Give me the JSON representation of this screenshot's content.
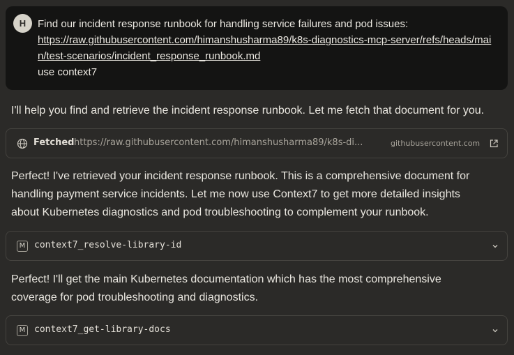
{
  "user_message": {
    "avatar_initial": "H",
    "line1": "Find our incident response runbook for handling service failures and pod issues:",
    "link": "https://raw.githubusercontent.com/himanshusharma89/k8s-diagnostics-mcp-server/refs/heads/main/test-scenarios/incident_response_runbook.md",
    "line_last": "use context7"
  },
  "assistant": {
    "para1": "I'll help you find and retrieve the incident response runbook. Let me fetch that document for you.",
    "fetch_card": {
      "label": "Fetched",
      "url": "https://raw.githubusercontent.com/himanshusharma89/k8s-di...",
      "domain": "githubusercontent.com"
    },
    "para2": "Perfect! I've retrieved your incident response runbook. This is a comprehensive document for handling payment service incidents. Let me now use Context7 to get more detailed insights about Kubernetes diagnostics and pod troubleshooting to complement your runbook.",
    "tool1": {
      "icon_letter": "M",
      "name": "context7_resolve-library-id"
    },
    "para3": "Perfect! I'll get the main Kubernetes documentation which has the most comprehensive coverage for pod troubleshooting and diagnostics.",
    "tool2": {
      "icon_letter": "M",
      "name": "context7_get-library-docs"
    }
  }
}
